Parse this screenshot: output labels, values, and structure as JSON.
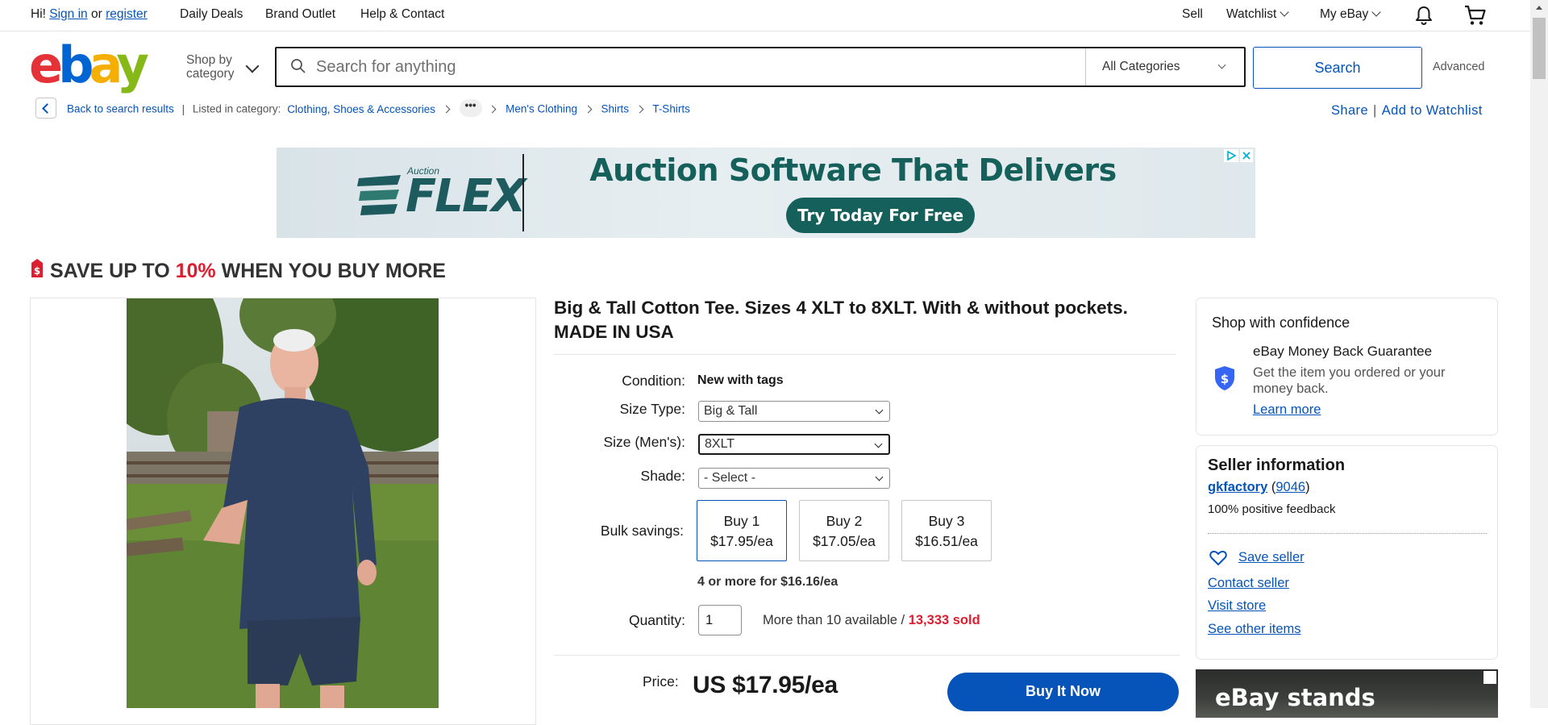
{
  "top_nav": {
    "greeting": "Hi!",
    "sign_in": "Sign in",
    "or": "or",
    "register": "register",
    "daily_deals": "Daily Deals",
    "brand_outlet": "Brand Outlet",
    "help_contact": "Help & Contact",
    "sell": "Sell",
    "watchlist": "Watchlist",
    "my_ebay": "My eBay"
  },
  "header": {
    "shop_by_line1": "Shop by",
    "shop_by_line2": "category",
    "search_placeholder": "Search for anything",
    "category_selected": "All Categories",
    "search_button": "Search",
    "advanced": "Advanced"
  },
  "breadcrumb": {
    "back": "Back to search results",
    "listed_in": "Listed in category:",
    "items": [
      "Clothing, Shoes & Accessories",
      "Men's Clothing",
      "Shirts",
      "T-Shirts"
    ],
    "more": "•••",
    "share": "Share",
    "add_to_watchlist": "Add to Watchlist"
  },
  "ad_banner": {
    "brand_small": "Auction",
    "brand": "FLEX",
    "headline": "Auction Software That Delivers",
    "cta": "Try Today For Free"
  },
  "promo": {
    "pre": "SAVE UP TO ",
    "pct": "10%",
    "post": " WHEN YOU BUY MORE"
  },
  "item": {
    "title": "Big & Tall Cotton Tee. Sizes 4 XLT to 8XLT. With & without pockets. MADE IN USA",
    "condition_label": "Condition:",
    "condition_value": "New with tags",
    "size_type_label": "Size Type:",
    "size_type_value": "Big & Tall",
    "size_label": "Size (Men's):",
    "size_value": "8XLT",
    "shade_label": "Shade:",
    "shade_value": "- Select -",
    "bulk_label": "Bulk savings:",
    "bulk_options": [
      {
        "qty": "Buy 1",
        "price": "$17.95/ea"
      },
      {
        "qty": "Buy 2",
        "price": "$17.05/ea"
      },
      {
        "qty": "Buy 3",
        "price": "$16.51/ea"
      }
    ],
    "bulk_note": "4 or more for $16.16/ea",
    "quantity_label": "Quantity:",
    "quantity_value": "1",
    "availability": "More than 10 available / ",
    "sold": "13,333 sold",
    "price_label": "Price:",
    "price": "US $17.95/ea",
    "buy_it_now": "Buy It Now"
  },
  "confidence": {
    "heading": "Shop with confidence",
    "guarantee": "eBay Money Back Guarantee",
    "description": "Get the item you ordered or your money back.",
    "learn_more": "Learn more"
  },
  "seller": {
    "heading": "Seller information",
    "name": "gkfactory",
    "open_paren": " (",
    "score": "9046",
    "close_paren": ")",
    "feedback": "100% positive feedback",
    "save_seller": "Save seller",
    "contact": "Contact seller",
    "visit_store": "Visit store",
    "other_items": "See other items"
  },
  "ad2": {
    "text": "eBay stands"
  },
  "colors": {
    "link": "#0654ba",
    "accent_red": "#dd1e31",
    "buy_button": "#0654ba"
  }
}
